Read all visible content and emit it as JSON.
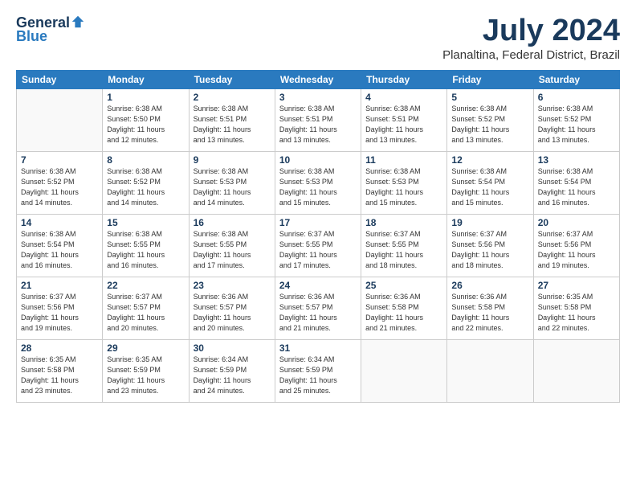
{
  "header": {
    "logo_general": "General",
    "logo_blue": "Blue",
    "main_title": "July 2024",
    "subtitle": "Planaltina, Federal District, Brazil"
  },
  "weekdays": [
    "Sunday",
    "Monday",
    "Tuesday",
    "Wednesday",
    "Thursday",
    "Friday",
    "Saturday"
  ],
  "weeks": [
    [
      {
        "day": "",
        "info": ""
      },
      {
        "day": "1",
        "info": "Sunrise: 6:38 AM\nSunset: 5:50 PM\nDaylight: 11 hours\nand 12 minutes."
      },
      {
        "day": "2",
        "info": "Sunrise: 6:38 AM\nSunset: 5:51 PM\nDaylight: 11 hours\nand 13 minutes."
      },
      {
        "day": "3",
        "info": "Sunrise: 6:38 AM\nSunset: 5:51 PM\nDaylight: 11 hours\nand 13 minutes."
      },
      {
        "day": "4",
        "info": "Sunrise: 6:38 AM\nSunset: 5:51 PM\nDaylight: 11 hours\nand 13 minutes."
      },
      {
        "day": "5",
        "info": "Sunrise: 6:38 AM\nSunset: 5:52 PM\nDaylight: 11 hours\nand 13 minutes."
      },
      {
        "day": "6",
        "info": "Sunrise: 6:38 AM\nSunset: 5:52 PM\nDaylight: 11 hours\nand 13 minutes."
      }
    ],
    [
      {
        "day": "7",
        "info": "Sunrise: 6:38 AM\nSunset: 5:52 PM\nDaylight: 11 hours\nand 14 minutes."
      },
      {
        "day": "8",
        "info": "Sunrise: 6:38 AM\nSunset: 5:52 PM\nDaylight: 11 hours\nand 14 minutes."
      },
      {
        "day": "9",
        "info": "Sunrise: 6:38 AM\nSunset: 5:53 PM\nDaylight: 11 hours\nand 14 minutes."
      },
      {
        "day": "10",
        "info": "Sunrise: 6:38 AM\nSunset: 5:53 PM\nDaylight: 11 hours\nand 15 minutes."
      },
      {
        "day": "11",
        "info": "Sunrise: 6:38 AM\nSunset: 5:53 PM\nDaylight: 11 hours\nand 15 minutes."
      },
      {
        "day": "12",
        "info": "Sunrise: 6:38 AM\nSunset: 5:54 PM\nDaylight: 11 hours\nand 15 minutes."
      },
      {
        "day": "13",
        "info": "Sunrise: 6:38 AM\nSunset: 5:54 PM\nDaylight: 11 hours\nand 16 minutes."
      }
    ],
    [
      {
        "day": "14",
        "info": "Sunrise: 6:38 AM\nSunset: 5:54 PM\nDaylight: 11 hours\nand 16 minutes."
      },
      {
        "day": "15",
        "info": "Sunrise: 6:38 AM\nSunset: 5:55 PM\nDaylight: 11 hours\nand 16 minutes."
      },
      {
        "day": "16",
        "info": "Sunrise: 6:38 AM\nSunset: 5:55 PM\nDaylight: 11 hours\nand 17 minutes."
      },
      {
        "day": "17",
        "info": "Sunrise: 6:37 AM\nSunset: 5:55 PM\nDaylight: 11 hours\nand 17 minutes."
      },
      {
        "day": "18",
        "info": "Sunrise: 6:37 AM\nSunset: 5:55 PM\nDaylight: 11 hours\nand 18 minutes."
      },
      {
        "day": "19",
        "info": "Sunrise: 6:37 AM\nSunset: 5:56 PM\nDaylight: 11 hours\nand 18 minutes."
      },
      {
        "day": "20",
        "info": "Sunrise: 6:37 AM\nSunset: 5:56 PM\nDaylight: 11 hours\nand 19 minutes."
      }
    ],
    [
      {
        "day": "21",
        "info": "Sunrise: 6:37 AM\nSunset: 5:56 PM\nDaylight: 11 hours\nand 19 minutes."
      },
      {
        "day": "22",
        "info": "Sunrise: 6:37 AM\nSunset: 5:57 PM\nDaylight: 11 hours\nand 20 minutes."
      },
      {
        "day": "23",
        "info": "Sunrise: 6:36 AM\nSunset: 5:57 PM\nDaylight: 11 hours\nand 20 minutes."
      },
      {
        "day": "24",
        "info": "Sunrise: 6:36 AM\nSunset: 5:57 PM\nDaylight: 11 hours\nand 21 minutes."
      },
      {
        "day": "25",
        "info": "Sunrise: 6:36 AM\nSunset: 5:58 PM\nDaylight: 11 hours\nand 21 minutes."
      },
      {
        "day": "26",
        "info": "Sunrise: 6:36 AM\nSunset: 5:58 PM\nDaylight: 11 hours\nand 22 minutes."
      },
      {
        "day": "27",
        "info": "Sunrise: 6:35 AM\nSunset: 5:58 PM\nDaylight: 11 hours\nand 22 minutes."
      }
    ],
    [
      {
        "day": "28",
        "info": "Sunrise: 6:35 AM\nSunset: 5:58 PM\nDaylight: 11 hours\nand 23 minutes."
      },
      {
        "day": "29",
        "info": "Sunrise: 6:35 AM\nSunset: 5:59 PM\nDaylight: 11 hours\nand 23 minutes."
      },
      {
        "day": "30",
        "info": "Sunrise: 6:34 AM\nSunset: 5:59 PM\nDaylight: 11 hours\nand 24 minutes."
      },
      {
        "day": "31",
        "info": "Sunrise: 6:34 AM\nSunset: 5:59 PM\nDaylight: 11 hours\nand 25 minutes."
      },
      {
        "day": "",
        "info": ""
      },
      {
        "day": "",
        "info": ""
      },
      {
        "day": "",
        "info": ""
      }
    ]
  ]
}
